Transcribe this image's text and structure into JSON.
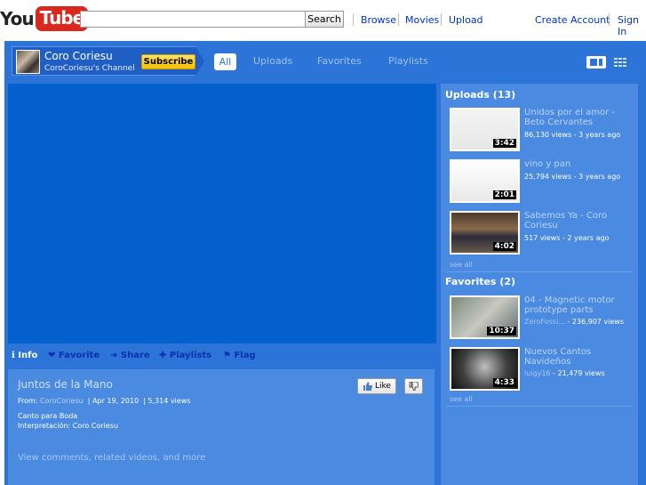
{
  "logo": {
    "you": "You",
    "tube": "Tube"
  },
  "search": {
    "placeholder": "",
    "value": "",
    "button_label": "Search"
  },
  "top_nav": {
    "browse": "Browse",
    "movies": "Movies",
    "upload": "Upload",
    "create_account": "Create Account",
    "sign_in": "Sign In"
  },
  "channel": {
    "name": "Coro Coriesu",
    "subtitle": "CoroCoriesu's Channel",
    "subscribe_label": "Subscribe",
    "tabs": [
      "All",
      "Uploads",
      "Favorites",
      "Playlists"
    ],
    "active_tab": "All"
  },
  "video_actions": [
    {
      "icon": "info-icon",
      "glyph": "ℹ",
      "label": "Info"
    },
    {
      "icon": "heart-icon",
      "glyph": "❤",
      "label": "Favorite"
    },
    {
      "icon": "share-arrow-icon",
      "glyph": "➔",
      "label": "Share"
    },
    {
      "icon": "plus-icon",
      "glyph": "✚",
      "label": "Playlists"
    },
    {
      "icon": "flag-icon",
      "glyph": "⚑",
      "label": "Flag"
    }
  ],
  "current_video": {
    "title": "Juntos de la Mano",
    "from_label": "From:",
    "author": "CoroCoriesu",
    "date": "Apr 19, 2010",
    "views": "5,314 views",
    "description_lines": [
      "Canto para Boda",
      "Interpretación: Coro Coriesu"
    ],
    "more_link": "View comments, related videos, and more",
    "like_label": "Like"
  },
  "uploads": {
    "title": "Uploads (13)",
    "see_all": "see all",
    "items": [
      {
        "title": "Unidos por el amor - Beto Cervantes",
        "user": "",
        "stats": "86,130 views - 3 years ago",
        "duration": "3:42"
      },
      {
        "title": "vino y pan",
        "user": "",
        "stats": "25,794 views - 3 years ago",
        "duration": "2:01"
      },
      {
        "title": "Sabemos Ya - Coro Coriesu",
        "user": "",
        "stats": "517 views - 2 years ago",
        "duration": "4:02"
      }
    ]
  },
  "favorites": {
    "title": "Favorites (2)",
    "see_all": "see all",
    "items": [
      {
        "title": "04 - Magnetic motor prototype parts",
        "user": "ZeroFossi...",
        "stats": " - 236,907 views",
        "duration": "10:37"
      },
      {
        "title": "Nuevos Cantos Navideños",
        "user": "luigy16",
        "stats": " - 21,479 views",
        "duration": "4:33"
      }
    ]
  },
  "colors": {
    "frame": "#2d74d8",
    "player": "#0360cd",
    "panel": "#4a8ae0",
    "subscribe": "#f6c000",
    "logo_red": "#d9281e"
  }
}
